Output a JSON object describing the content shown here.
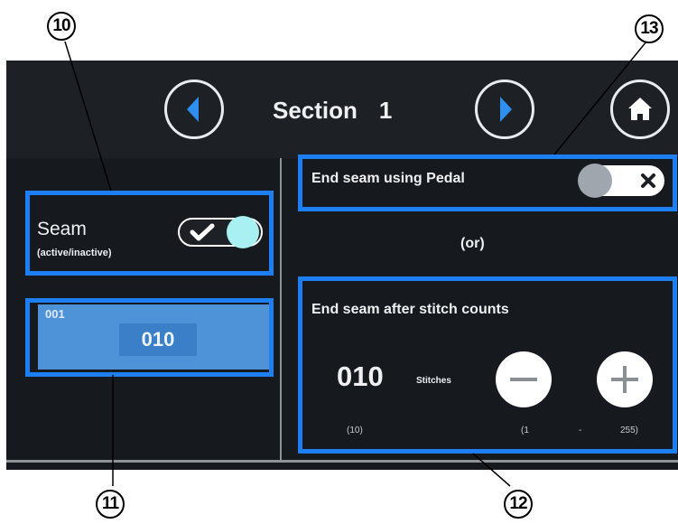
{
  "header": {
    "title": "Section",
    "section_number": "1"
  },
  "seam_panel": {
    "label": "Seam",
    "sublabel": "(active/inactive)",
    "toggle_state": "on"
  },
  "seam_selector": {
    "index": "001",
    "value": "010"
  },
  "pedal_option": {
    "label": "End seam using Pedal",
    "toggle_state": "off"
  },
  "or_text": "(or)",
  "stitch_option": {
    "label": "End seam after stitch counts",
    "count_value": "010",
    "unit": "Stitches",
    "default_note": "(10)",
    "range_min": "(1",
    "range_sep": "-",
    "range_max": "255)"
  },
  "callouts": {
    "c10": "10",
    "c11": "11",
    "c12": "12",
    "c13": "13"
  },
  "icons": {
    "prev": "chevron-left-icon",
    "next": "chevron-right-icon",
    "home": "home-icon",
    "check": "check-icon",
    "x": "close-icon",
    "minus": "minus-icon",
    "plus": "plus-icon"
  },
  "colors": {
    "screen_bg": "#16191d",
    "accent_blue": "#4e92d8",
    "highlight_blue": "#1e7ff5",
    "toggle_knob": "#a9f0f2"
  }
}
